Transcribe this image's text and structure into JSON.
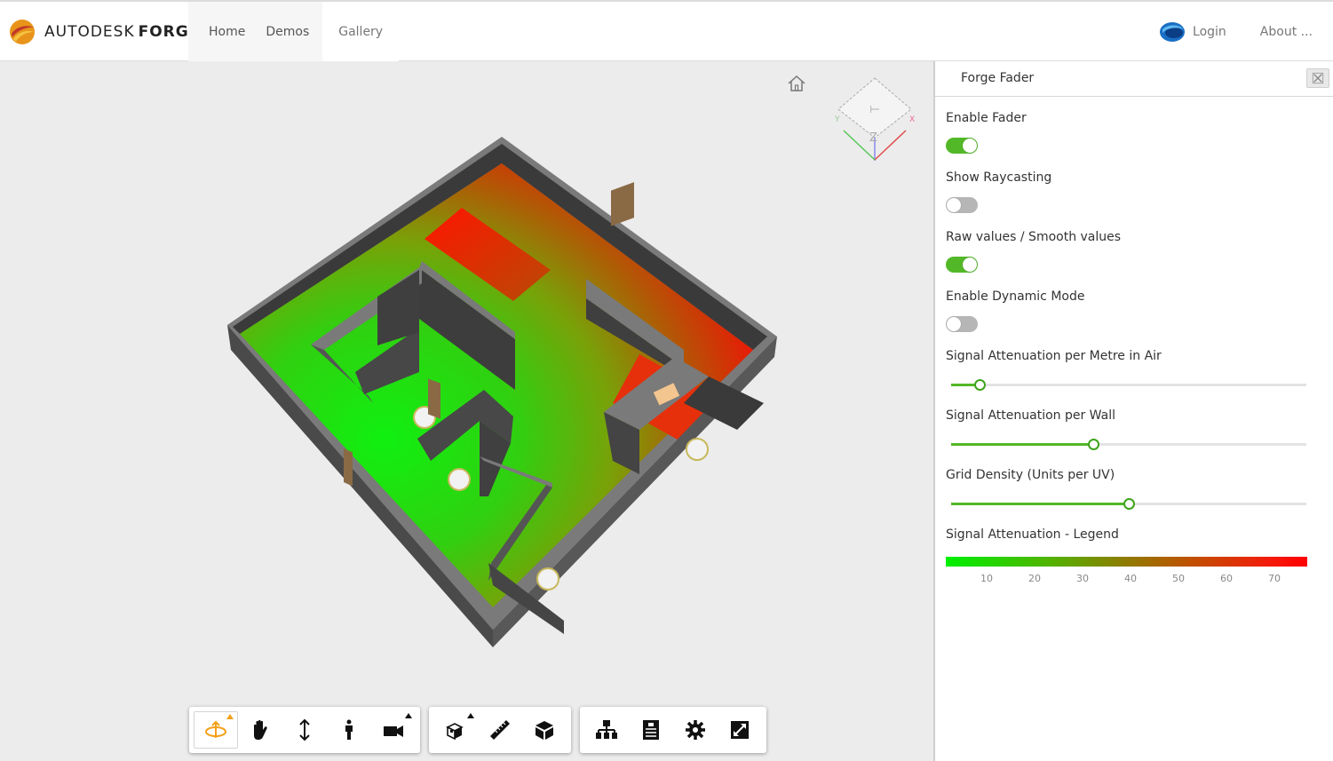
{
  "header": {
    "brand_main": "AUTODESK",
    "brand_sub": "FORGE",
    "nav": [
      {
        "label": "Home"
      },
      {
        "label": "Demos"
      },
      {
        "label": "Gallery"
      }
    ],
    "login_label": "Login",
    "about_label": "About ..."
  },
  "viewer": {
    "toolbar_groups": [
      {
        "name": "navigation",
        "tools": [
          {
            "icon": "orbit-icon",
            "active": true,
            "has_menu": true
          },
          {
            "icon": "pan-hand-icon"
          },
          {
            "icon": "zoom-icon"
          },
          {
            "icon": "first-person-icon"
          },
          {
            "icon": "camera-icon",
            "has_menu": true
          }
        ]
      },
      {
        "name": "modeling",
        "tools": [
          {
            "icon": "explode-icon",
            "has_menu": true
          },
          {
            "icon": "measure-ruler-icon"
          },
          {
            "icon": "section-cube-icon"
          }
        ]
      },
      {
        "name": "settings",
        "tools": [
          {
            "icon": "model-browser-icon"
          },
          {
            "icon": "properties-icon"
          },
          {
            "icon": "settings-gear-icon"
          },
          {
            "icon": "fullscreen-icon"
          }
        ]
      }
    ]
  },
  "panel": {
    "title": "Forge Fader",
    "toggles": [
      {
        "label": "Enable Fader",
        "on": true
      },
      {
        "label": "Show Raycasting",
        "on": false
      },
      {
        "label": "Raw values / Smooth values",
        "on": true
      },
      {
        "label": "Enable Dynamic Mode",
        "on": false
      }
    ],
    "sliders": [
      {
        "label": "Signal Attenuation per Metre in Air",
        "value_fraction": 0.08
      },
      {
        "label": "Signal Attenuation per Wall",
        "value_fraction": 0.4
      },
      {
        "label": "Grid Density (Units per UV)",
        "value_fraction": 0.5
      }
    ],
    "legend": {
      "label": "Signal Attenuation - Legend",
      "ticks": [
        "10",
        "20",
        "30",
        "40",
        "50",
        "60",
        "70"
      ],
      "colors": {
        "low": "#00f000",
        "high": "#ff0000"
      }
    }
  }
}
